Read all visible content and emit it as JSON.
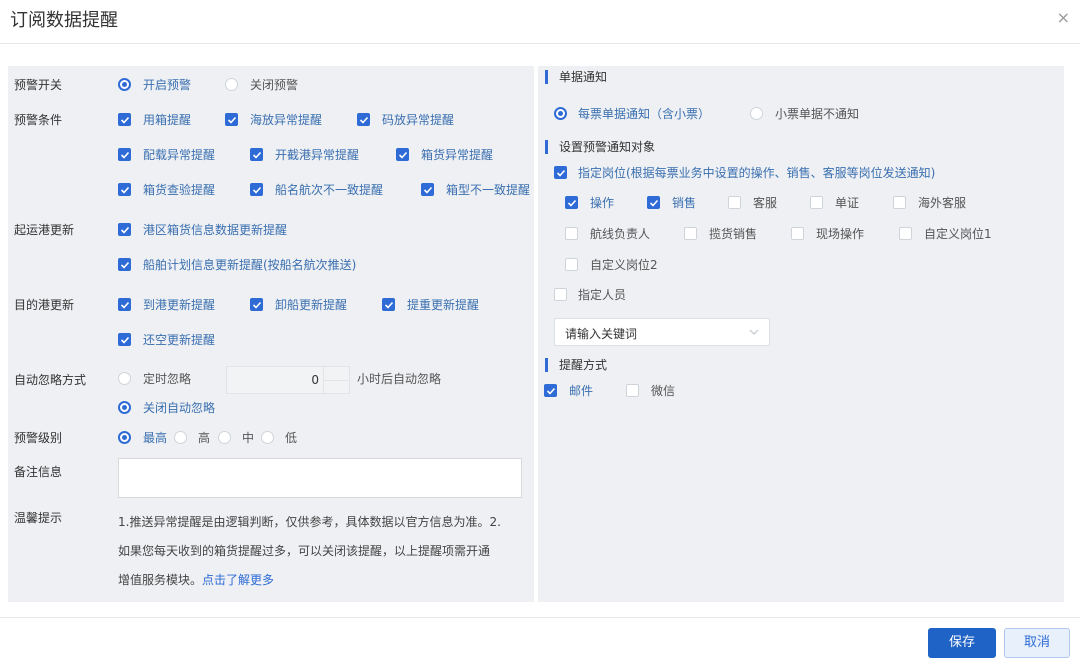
{
  "dialog": {
    "title": "订阅数据提醒",
    "close": "×"
  },
  "left": {
    "switch": {
      "label": "预警开关",
      "on": "开启预警",
      "off": "关闭预警"
    },
    "conditions": {
      "label": "预警条件",
      "items": [
        "用箱提醒",
        "海放异常提醒",
        "码放异常提醒",
        "配载异常提醒",
        "开截港异常提醒",
        "箱货异常提醒",
        "箱货查验提醒",
        "船名航次不一致提醒",
        "箱型不一致提醒"
      ]
    },
    "origin": {
      "label": "起运港更新",
      "items": [
        "港区箱货信息数据更新提醒",
        "船舶计划信息更新提醒(按船名航次推送)"
      ]
    },
    "dest": {
      "label": "目的港更新",
      "items": [
        "到港更新提醒",
        "卸船更新提醒",
        "提重更新提醒",
        "还空更新提醒"
      ]
    },
    "auto_ignore": {
      "label": "自动忽略方式",
      "timed": "定时忽略",
      "value": "0",
      "suffix": "小时后自动忽略",
      "off": "关闭自动忽略"
    },
    "level": {
      "label": "预警级别",
      "options": [
        "最高",
        "高",
        "中",
        "低"
      ]
    },
    "note": {
      "label": "备注信息"
    },
    "tip": {
      "label": "温馨提示",
      "line1": "1.推送异常提醒是由逻辑判断，仅供参考，具体数据以官方信息为准。2.",
      "line2": "如果您每天收到的箱货提醒过多，可以关闭该提醒，以上提醒项需开通",
      "line3": "增值服务模块。",
      "link": "点击了解更多"
    }
  },
  "right": {
    "single": {
      "title": "单据通知",
      "opt1": "每票单据通知（含小票）",
      "opt2": "小票单据不通知"
    },
    "target": {
      "title": "设置预警通知对象",
      "position_label": "指定岗位(根据每票业务中设置的操作、销售、客服等岗位发送通知)",
      "positions": [
        "操作",
        "销售",
        "客服",
        "单证",
        "海外客服",
        "航线负责人",
        "揽货销售",
        "现场操作",
        "自定义岗位1",
        "自定义岗位2"
      ],
      "person_label": "指定人员",
      "placeholder": "请输入关键词"
    },
    "method": {
      "title": "提醒方式",
      "email": "邮件",
      "wechat": "微信"
    }
  },
  "footer": {
    "save": "保存",
    "cancel": "取消"
  },
  "colors": {
    "accent": "#2e6bd6",
    "panel": "#eef0f3"
  }
}
